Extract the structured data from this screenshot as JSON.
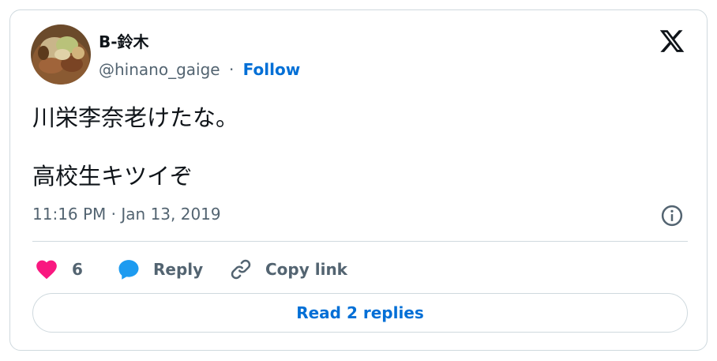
{
  "author": {
    "display_name": "B-鈴木",
    "handle": "@hinano_gaige",
    "separator": "·",
    "follow_label": "Follow"
  },
  "tweet": {
    "line1": "川栄李奈老けたな。",
    "line2": "高校生キツイぞ",
    "timestamp": "11:16 PM · Jan 13, 2019"
  },
  "actions": {
    "like_count": "6",
    "reply_label": "Reply",
    "copy_link_label": "Copy link"
  },
  "read_replies_label": "Read 2 replies",
  "colors": {
    "like": "#f91880",
    "reply": "#1d9bf0",
    "link": "#006fd6",
    "text": "#0f1419",
    "muted": "#536471",
    "border": "#cfd9de"
  },
  "icons": {
    "brand": "x-logo-icon",
    "info": "info-icon",
    "like": "heart-icon",
    "reply": "speech-bubble-icon",
    "copy": "link-icon"
  }
}
